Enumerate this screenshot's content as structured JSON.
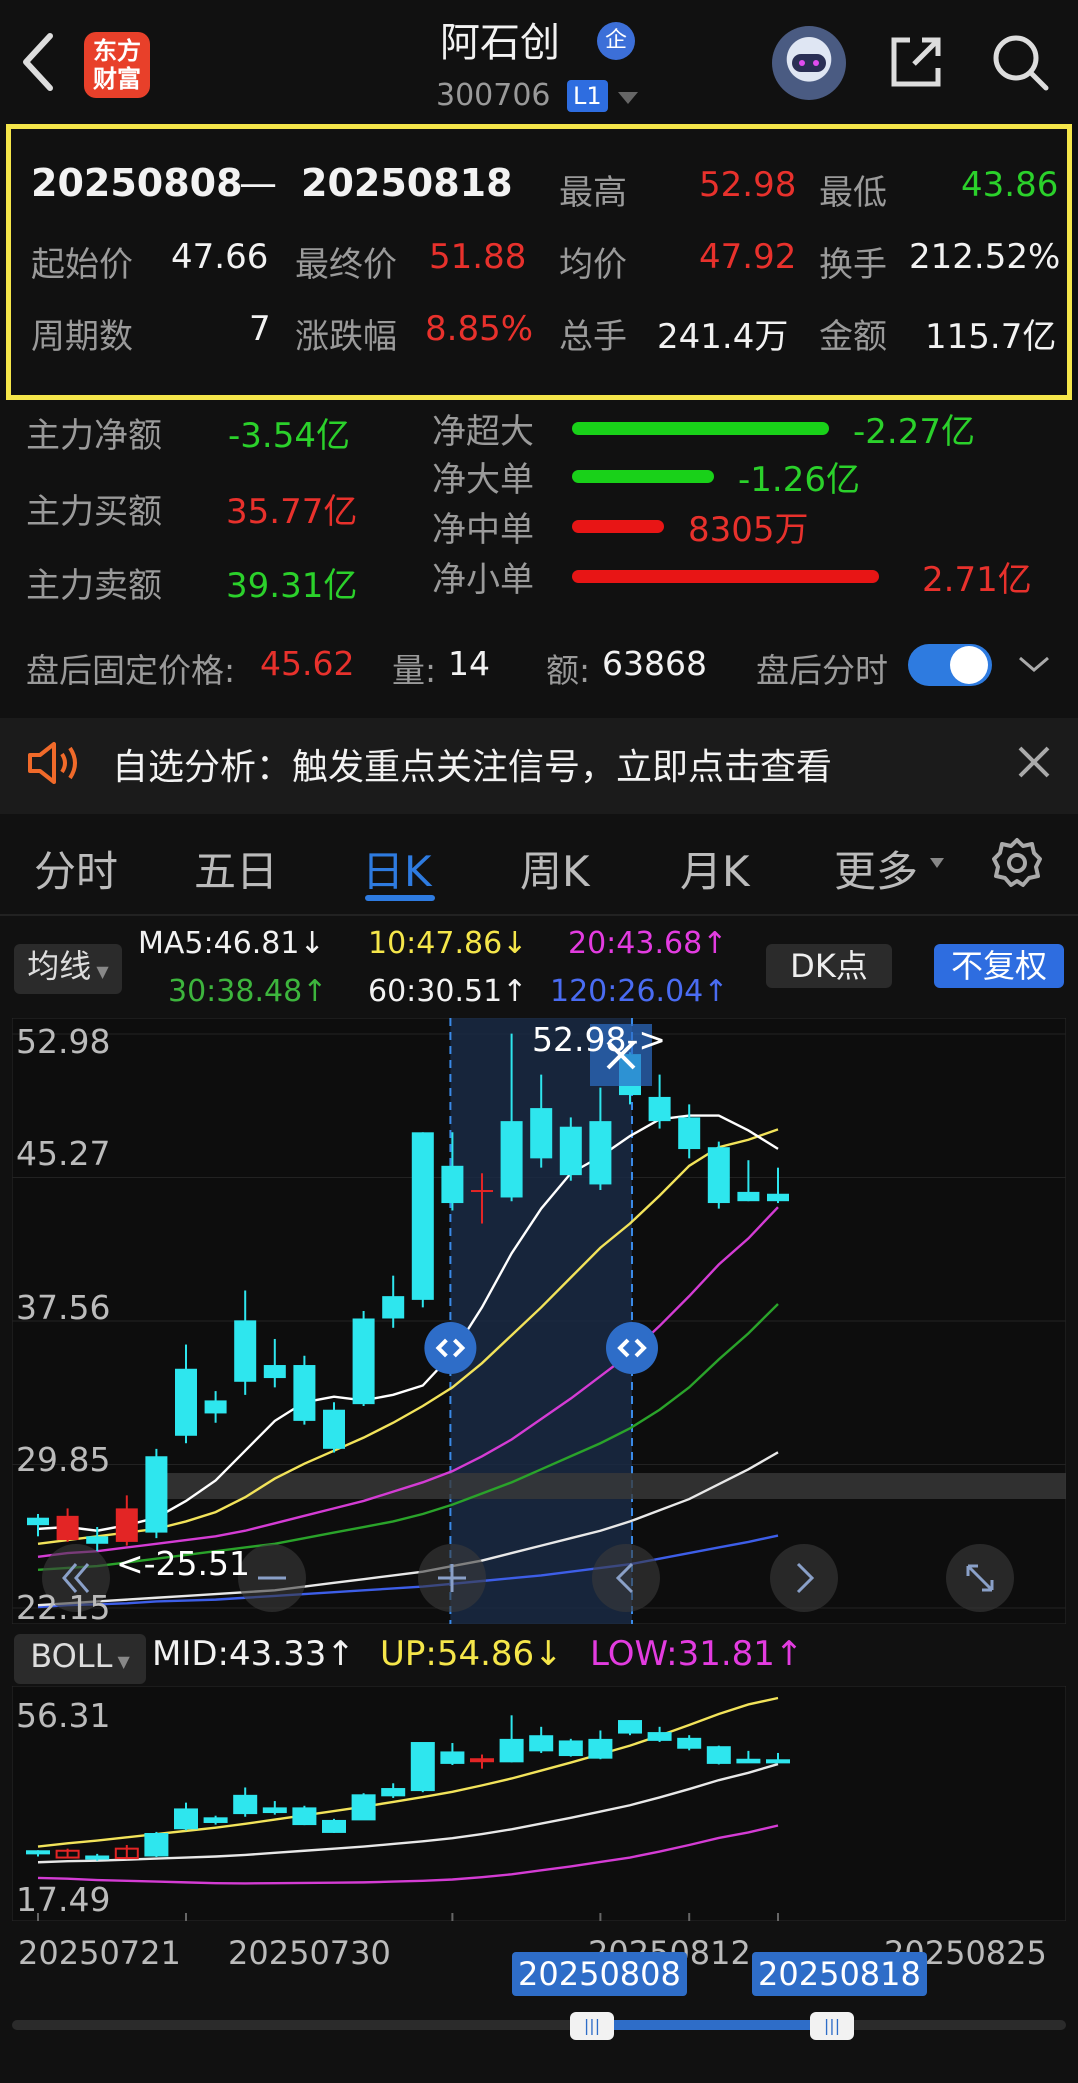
{
  "header": {
    "stock_name": "阿石创",
    "qy_badge": "企",
    "stock_code": "300706",
    "level": "L1",
    "logo_line1": "东方",
    "logo_line2": "财富",
    "icons": [
      "back-icon",
      "robot-avatar",
      "share-icon",
      "search-icon"
    ]
  },
  "summary": {
    "start_date": "20250808",
    "dash": "—",
    "end_date": "20250818",
    "high_label": "最高",
    "high": "52.98",
    "low_label": "最低",
    "low": "43.86",
    "open_label": "起始价",
    "open": "47.66",
    "close_label": "最终价",
    "close": "51.88",
    "avg_label": "均价",
    "avg": "47.92",
    "turnover_label": "换手",
    "turnover": "212.52%",
    "periods_label": "周期数",
    "periods": "7",
    "change_label": "涨跌幅",
    "change": "8.85%",
    "volume_label": "总手",
    "volume": "241.4万",
    "amount_label": "金额",
    "amount": "115.7亿"
  },
  "flow": {
    "main_net_label": "主力净额",
    "main_net": "-3.54亿",
    "main_buy_label": "主力买额",
    "main_buy": "35.77亿",
    "main_sell_label": "主力卖额",
    "main_sell": "39.31亿",
    "rows": [
      {
        "label": "净超大",
        "value": "-2.27亿",
        "fraction": 0.78,
        "color": "#19d119"
      },
      {
        "label": "净大单",
        "value": "-1.26亿",
        "fraction": 0.43,
        "color": "#19d119"
      },
      {
        "label": "净中单",
        "value": "8305万",
        "fraction": 0.28,
        "color": "#e81515"
      },
      {
        "label": "净小单",
        "value": "2.71亿",
        "fraction": 0.93,
        "color": "#e81515"
      }
    ]
  },
  "after_hours": {
    "price_label": "盘后固定价格:",
    "price": "45.62",
    "qty_label": "量:",
    "qty": "14",
    "amount_label": "额:",
    "amount": "63868",
    "toggle_label": "盘后分时",
    "toggle_on": true
  },
  "notice": {
    "text": "自选分析：触发重点关注信号，立即点击查看"
  },
  "tabs": [
    {
      "label": "分时",
      "active": false
    },
    {
      "label": "五日",
      "active": false
    },
    {
      "label": "日K",
      "active": true
    },
    {
      "label": "周K",
      "active": false
    },
    {
      "label": "月K",
      "active": false
    },
    {
      "label": "更多",
      "active": false
    }
  ],
  "ma_row": {
    "type_label": "均线",
    "ma5": "MA5:46.81↓",
    "ma10": "10:47.86↓",
    "ma20": "20:43.68↑",
    "ma30": "30:38.48↑",
    "ma60": "60:30.51↑",
    "ma120": "120:26.04↑",
    "dk_label": "DK点",
    "adjust_label": "不复权"
  },
  "colors": {
    "up": "#e32525",
    "down": "#2ee6ee",
    "ma5": "#ffffff",
    "ma10": "#f2e35a",
    "ma20": "#d43cd4",
    "ma30": "#2aa32a",
    "ma60": "#e8e8e8",
    "ma120": "#3d5ee8",
    "accent": "#2e7be0",
    "highlight": "#f5e64a"
  },
  "chart_data": [
    {
      "type": "candlestick",
      "title": "",
      "y_ticks": [
        "52.98",
        "45.27",
        "37.56",
        "29.85",
        "22.15"
      ],
      "ylim": [
        22.15,
        52.98
      ],
      "max_label": "52.98->",
      "min_label": "<-25.51",
      "candles": [
        {
          "o": 27.0,
          "c": 26.6,
          "h": 27.2,
          "l": 26.0
        },
        {
          "o": 25.8,
          "c": 27.1,
          "h": 27.5,
          "l": 25.7
        },
        {
          "o": 26.0,
          "c": 25.6,
          "h": 26.5,
          "l": 25.2
        },
        {
          "o": 25.7,
          "c": 27.5,
          "h": 28.2,
          "l": 25.5
        },
        {
          "o": 30.3,
          "c": 26.2,
          "h": 30.7,
          "l": 25.9
        },
        {
          "o": 35.0,
          "c": 31.4,
          "h": 36.3,
          "l": 31.0
        },
        {
          "o": 33.3,
          "c": 32.6,
          "h": 33.8,
          "l": 32.1
        },
        {
          "o": 37.6,
          "c": 34.3,
          "h": 39.2,
          "l": 33.6
        },
        {
          "o": 35.2,
          "c": 34.5,
          "h": 36.6,
          "l": 34.0
        },
        {
          "o": 35.2,
          "c": 32.2,
          "h": 35.7,
          "l": 32.0
        },
        {
          "o": 32.8,
          "c": 30.7,
          "h": 33.2,
          "l": 30.5
        },
        {
          "o": 37.7,
          "c": 33.1,
          "h": 38.1,
          "l": 33.0
        },
        {
          "o": 38.9,
          "c": 37.7,
          "h": 40.0,
          "l": 37.2
        },
        {
          "o": 47.7,
          "c": 38.7,
          "h": 47.7,
          "l": 38.3
        },
        {
          "o": 45.9,
          "c": 43.9,
          "h": 47.7,
          "l": 43.5
        },
        {
          "o": 44.6,
          "c": 44.6,
          "h": 45.5,
          "l": 42.8
        },
        {
          "o": 48.3,
          "c": 44.2,
          "h": 53.0,
          "l": 44.0
        },
        {
          "o": 49.0,
          "c": 46.3,
          "h": 50.8,
          "l": 45.8
        },
        {
          "o": 48.0,
          "c": 45.4,
          "h": 48.5,
          "l": 45.1
        },
        {
          "o": 48.3,
          "c": 44.9,
          "h": 50.1,
          "l": 44.6
        },
        {
          "o": 51.9,
          "c": 49.7,
          "h": 52.0,
          "l": 49.2
        },
        {
          "o": 49.6,
          "c": 48.3,
          "h": 50.8,
          "l": 47.9
        },
        {
          "o": 48.5,
          "c": 46.8,
          "h": 49.2,
          "l": 46.3
        },
        {
          "o": 46.9,
          "c": 43.9,
          "h": 47.2,
          "l": 43.6
        },
        {
          "o": 44.5,
          "c": 44.0,
          "h": 46.2,
          "l": 44.0
        },
        {
          "o": 44.4,
          "c": 44.0,
          "h": 45.8,
          "l": 43.9
        }
      ],
      "ma5": [
        26.4,
        26.5,
        26.3,
        26.6,
        27.0,
        27.9,
        29.0,
        30.6,
        32.2,
        33.2,
        33.5,
        33.3,
        33.6,
        34.1,
        35.8,
        38.3,
        41.2,
        43.6,
        45.5,
        46.4,
        47.5,
        48.4,
        48.6,
        48.6,
        47.8,
        46.81
      ],
      "ma10": [
        25.6,
        25.8,
        26.0,
        26.2,
        26.4,
        26.8,
        27.3,
        28.1,
        29.1,
        29.9,
        30.6,
        31.3,
        32.1,
        33.0,
        34.0,
        35.3,
        36.8,
        38.3,
        39.9,
        41.5,
        42.8,
        44.3,
        45.9,
        46.9,
        47.3,
        47.86
      ],
      "ma20": [
        24.9,
        25.1,
        25.2,
        25.4,
        25.6,
        25.8,
        26.0,
        26.3,
        26.7,
        27.1,
        27.5,
        27.9,
        28.4,
        28.9,
        29.5,
        30.3,
        31.2,
        32.3,
        33.4,
        34.6,
        35.8,
        37.3,
        38.9,
        40.6,
        42.0,
        43.68
      ],
      "ma30": [
        24.2,
        24.3,
        24.4,
        24.6,
        24.8,
        25.0,
        25.2,
        25.4,
        25.6,
        25.9,
        26.2,
        26.5,
        26.8,
        27.2,
        27.7,
        28.3,
        28.9,
        29.6,
        30.3,
        31.0,
        31.8,
        32.8,
        34.0,
        35.5,
        36.9,
        38.48
      ],
      "ma60": [
        22.3,
        22.4,
        22.5,
        22.6,
        22.7,
        22.8,
        22.9,
        23.0,
        23.1,
        23.3,
        23.5,
        23.7,
        23.9,
        24.1,
        24.4,
        24.7,
        25.1,
        25.5,
        25.9,
        26.3,
        26.8,
        27.4,
        28.0,
        28.8,
        29.6,
        30.51
      ],
      "ma120": [
        22.2,
        22.3,
        22.35,
        22.4,
        22.5,
        22.55,
        22.6,
        22.7,
        22.8,
        22.9,
        23.0,
        23.1,
        23.2,
        23.3,
        23.45,
        23.6,
        23.75,
        23.9,
        24.1,
        24.3,
        24.5,
        24.8,
        25.1,
        25.4,
        25.7,
        26.04
      ],
      "selection_start_index": 14,
      "selection_end_index": 20
    },
    {
      "type": "bollinger",
      "title": "",
      "label": "BOLL",
      "mid_label": "MID:43.33↑",
      "up_label": "UP:54.86↓",
      "low_label": "LOW:31.81↑",
      "y_ticks": [
        "56.31",
        "17.49"
      ],
      "ylim": [
        17.49,
        56.31
      ],
      "x_ticks": [
        "20250721",
        "20250730",
        "20250812",
        "20250825"
      ],
      "selection_tags": [
        "20250808",
        "20250818"
      ]
    }
  ]
}
